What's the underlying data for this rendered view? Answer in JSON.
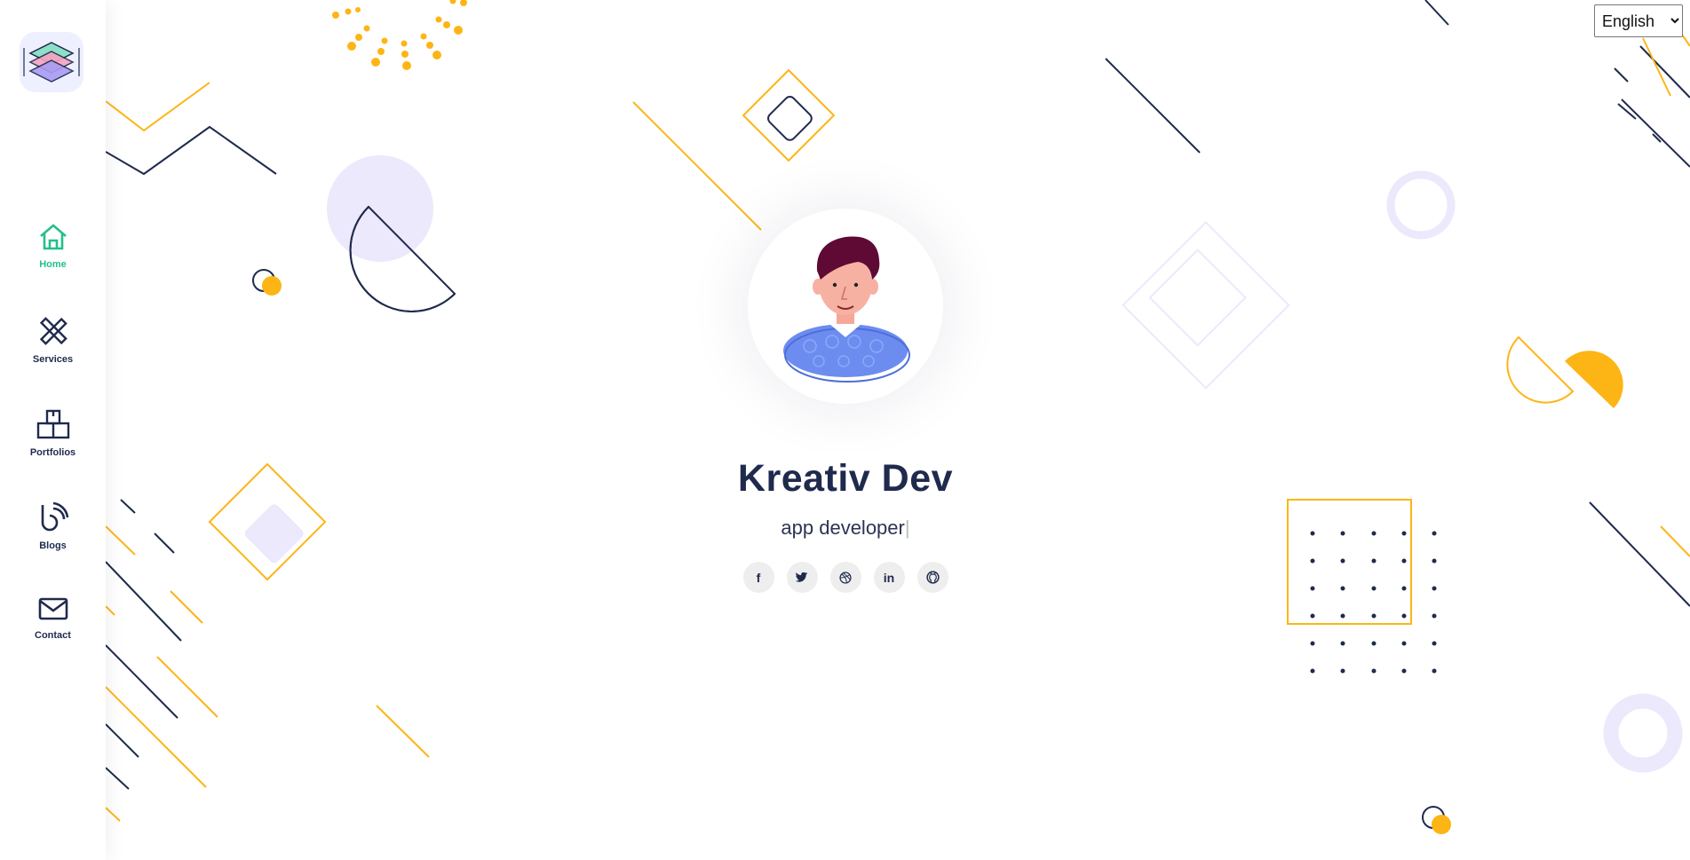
{
  "colors": {
    "accent_yellow": "#fdb515",
    "navy": "#1f2a4d",
    "active_green": "#24c08a",
    "lavender": "#ebe9fb"
  },
  "sidebar": {
    "logo_icon": "layers-logo",
    "items": [
      {
        "label": "Home",
        "icon": "home-icon",
        "active": true
      },
      {
        "label": "Services",
        "icon": "tools-icon",
        "active": false
      },
      {
        "label": "Portfolios",
        "icon": "portfolio-icon",
        "active": false
      },
      {
        "label": "Blogs",
        "icon": "blog-icon",
        "active": false
      },
      {
        "label": "Contact",
        "icon": "mail-icon",
        "active": false
      }
    ]
  },
  "language": {
    "selected": "English",
    "options": [
      "English"
    ]
  },
  "hero": {
    "name": "Kreativ Dev",
    "role": "app developer",
    "cursor": "|",
    "socials": [
      {
        "network": "facebook",
        "glyph": "f"
      },
      {
        "network": "twitter",
        "glyph": "t"
      },
      {
        "network": "dribbble",
        "glyph": "◎"
      },
      {
        "network": "linkedin",
        "glyph": "in"
      },
      {
        "network": "github",
        "glyph": "gh"
      }
    ]
  }
}
